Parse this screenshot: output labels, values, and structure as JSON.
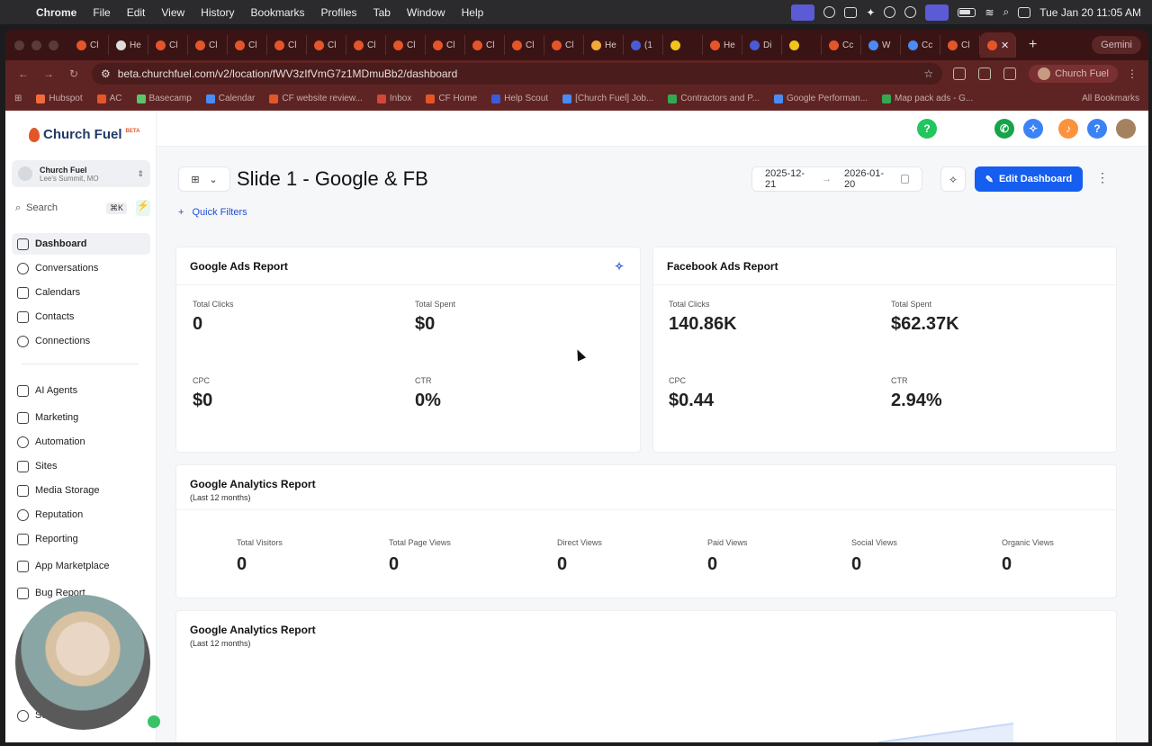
{
  "menubar": {
    "app": "Chrome",
    "items": [
      "File",
      "Edit",
      "View",
      "History",
      "Bookmarks",
      "Profiles",
      "Tab",
      "Window",
      "Help"
    ],
    "datetime": "Tue Jan 20  11:05 AM"
  },
  "browser": {
    "tabs": [
      {
        "label": "Cl",
        "fav_color": "#e4562a"
      },
      {
        "label": "He",
        "fav_color": "#dddddd"
      },
      {
        "label": "Cl",
        "fav_color": "#e4562a"
      },
      {
        "label": "Cl",
        "fav_color": "#e4562a"
      },
      {
        "label": "Cl",
        "fav_color": "#e4562a"
      },
      {
        "label": "Cl",
        "fav_color": "#e4562a"
      },
      {
        "label": "Cl",
        "fav_color": "#e4562a"
      },
      {
        "label": "Cl",
        "fav_color": "#e4562a"
      },
      {
        "label": "Cl",
        "fav_color": "#e4562a"
      },
      {
        "label": "Cl",
        "fav_color": "#e4562a"
      },
      {
        "label": "Cl",
        "fav_color": "#e4562a"
      },
      {
        "label": "Cl",
        "fav_color": "#e4562a"
      },
      {
        "label": "Cl",
        "fav_color": "#e4562a"
      },
      {
        "label": "He",
        "fav_color": "#f2a93b"
      },
      {
        "label": "(1",
        "fav_color": "#4a5bd6"
      },
      {
        "label": "",
        "fav_color": "#f0c419"
      },
      {
        "label": "He",
        "fav_color": "#e4562a"
      },
      {
        "label": "Di",
        "fav_color": "#4a5bd6"
      },
      {
        "label": "",
        "fav_color": "#f0c419"
      },
      {
        "label": "Cc",
        "fav_color": "#e4562a"
      },
      {
        "label": "W",
        "fav_color": "#4a8bf5"
      },
      {
        "label": "Cc",
        "fav_color": "#4a8bf5"
      },
      {
        "label": "Cl",
        "fav_color": "#e4562a"
      }
    ],
    "gemini_label": "Gemini",
    "url": "beta.churchfuel.com/v2/location/fWV3zIfVmG7z1MDmuBb2/dashboard",
    "profile_label": "Church Fuel",
    "bookmarks": [
      {
        "label": "Hubspot",
        "color": "#f26b3a"
      },
      {
        "label": "AC",
        "color": "#e4562a"
      },
      {
        "label": "Basecamp",
        "color": "#5ec46a"
      },
      {
        "label": "Calendar",
        "color": "#4a8bf5"
      },
      {
        "label": "CF website review...",
        "color": "#e4562a"
      },
      {
        "label": "Inbox",
        "color": "#d44638"
      },
      {
        "label": "CF Home",
        "color": "#e4562a"
      },
      {
        "label": "Help Scout",
        "color": "#3b5bdb"
      },
      {
        "label": "[Church Fuel] Job...",
        "color": "#4a8bf5"
      },
      {
        "label": "Contractors and P...",
        "color": "#34a853"
      },
      {
        "label": "Google Performan...",
        "color": "#4a8bf5"
      },
      {
        "label": "Map pack ads - G...",
        "color": "#34a853"
      }
    ],
    "all_bookmarks_label": "All Bookmarks"
  },
  "sidebar": {
    "logo_text": "Church Fuel",
    "logo_badge": "BETA",
    "account_name": "Church Fuel",
    "account_location": "Lee's Summit, MO",
    "search_placeholder": "Search",
    "search_shortcut": "⌘K",
    "nav_primary": [
      "Dashboard",
      "Conversations",
      "Calendars",
      "Contacts",
      "Connections"
    ],
    "nav_secondary": [
      "AI Agents",
      "Marketing",
      "Automation",
      "Sites",
      "Media Storage",
      "Reputation",
      "Reporting",
      "App Marketplace",
      "Bug Report"
    ],
    "settings_label": "Se"
  },
  "header": {
    "dashboard_title": "Slide 1 - Google & FB",
    "quick_filters_label": "Quick Filters",
    "date_start": "2025-12-21",
    "date_end": "2026-01-20",
    "edit_button_label": "Edit Dashboard"
  },
  "google_ads": {
    "title": "Google Ads Report",
    "total_clicks_label": "Total Clicks",
    "total_clicks": "0",
    "total_spent_label": "Total Spent",
    "total_spent": "$0",
    "cpc_label": "CPC",
    "cpc": "$0",
    "ctr_label": "CTR",
    "ctr": "0%"
  },
  "facebook_ads": {
    "title": "Facebook Ads Report",
    "total_clicks_label": "Total Clicks",
    "total_clicks": "140.86K",
    "total_spent_label": "Total Spent",
    "total_spent": "$62.37K",
    "cpc_label": "CPC",
    "cpc": "$0.44",
    "ctr_label": "CTR",
    "ctr": "2.94%"
  },
  "analytics1": {
    "title": "Google Analytics Report",
    "subtitle": "(Last 12 months)",
    "metrics": [
      {
        "label": "Total Visitors",
        "value": "0"
      },
      {
        "label": "Total Page Views",
        "value": "0"
      },
      {
        "label": "Direct Views",
        "value": "0"
      },
      {
        "label": "Paid Views",
        "value": "0"
      },
      {
        "label": "Social Views",
        "value": "0"
      },
      {
        "label": "Organic Views",
        "value": "0"
      }
    ]
  },
  "analytics2": {
    "title": "Google Analytics Report",
    "subtitle": "(Last 12 months)"
  },
  "colors": {
    "accent": "#155eef",
    "brand_orange": "#e4562a",
    "help_green": "#22c55e",
    "phone_green": "#16a34a",
    "bell_orange": "#fb923c",
    "question_blue": "#3b82f6"
  }
}
